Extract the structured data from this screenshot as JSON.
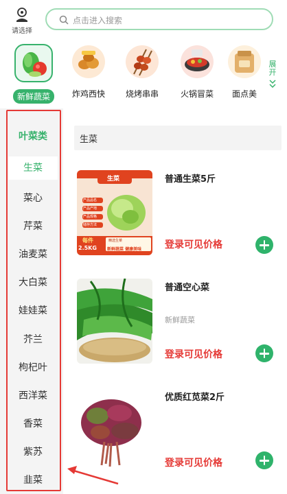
{
  "location": {
    "label": "请选择"
  },
  "search": {
    "placeholder": "点击进入搜索"
  },
  "categories": [
    {
      "name": "新鲜蔬菜",
      "active": true
    },
    {
      "name": "炸鸡西快"
    },
    {
      "name": "烧烤串串"
    },
    {
      "name": "火锅冒菜"
    },
    {
      "name": "面点美"
    }
  ],
  "more_label": "展开",
  "sidebar": {
    "heading": "叶菜类",
    "items": [
      "生菜",
      "菜心",
      "芹菜",
      "油麦菜",
      "大白菜",
      "娃娃菜",
      "芥兰",
      "枸杞叶",
      "西洋菜",
      "香菜",
      "紫苏",
      "韭菜"
    ],
    "active_index": 0
  },
  "section_title": "生菜",
  "products": [
    {
      "name": "普通生菜5斤",
      "tag": "",
      "price": "登录可见价格",
      "image_text": {
        "banner": "生菜",
        "bullets": [
          "产品品名",
          "产品产地",
          "产品规格",
          "储存方法"
        ],
        "unit_label": "每件",
        "weight": "2.5KG",
        "fresh": "新鲜蔬菜 健康美味",
        "note": "精选生菜"
      }
    },
    {
      "name": "普通空心菜",
      "tag": "新鲜蔬菜",
      "price": "登录可见价格"
    },
    {
      "name": "优质红苋菜2斤",
      "tag": "",
      "price": "登录可见价格"
    }
  ],
  "colors": {
    "accent": "#37b26c",
    "price": "#e53935",
    "annotation": "#e53935"
  }
}
